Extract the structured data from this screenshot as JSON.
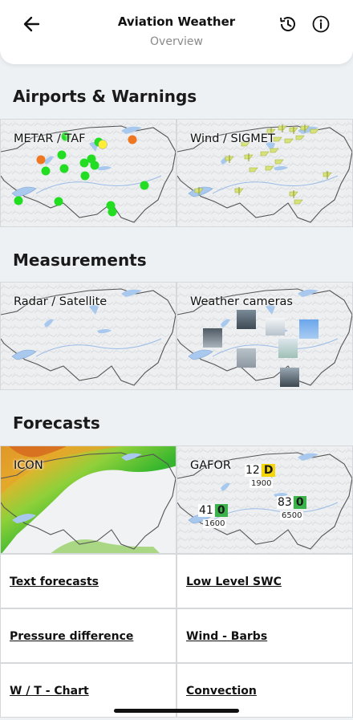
{
  "header": {
    "title": "Aviation Weather",
    "subtitle": "Overview"
  },
  "sections": {
    "airports": "Airports & Warnings",
    "measurements": "Measurements",
    "forecasts": "Forecasts"
  },
  "tiles": {
    "metar": "METAR / TAF",
    "wind_sigmet": "Wind / SIGMET",
    "radar": "Radar / Satellite",
    "cameras": "Weather cameras",
    "icon": "ICON",
    "gafor": "GAFOR"
  },
  "gafor": [
    {
      "num": "12",
      "code": "D",
      "alt": "1900",
      "color": "#f5d60a"
    },
    {
      "num": "41",
      "code": "0",
      "alt": "1600",
      "color": "#3cb34a"
    },
    {
      "num": "83",
      "code": "0",
      "alt": "6500",
      "color": "#3cb34a"
    }
  ],
  "links": {
    "text_forecasts": "Text forecasts",
    "low_level_swc": "Low Level SWC",
    "pressure_difference": "Pressure difference",
    "wind_barbs": "Wind - Barbs",
    "wt_chart": "W / T - Chart",
    "convection": "Convection"
  },
  "colors": {
    "station_green": "#22dd22",
    "station_orange": "#ee7722",
    "station_yellow": "#ffee33",
    "lake": "#a8c8ee",
    "border": "#555555"
  }
}
